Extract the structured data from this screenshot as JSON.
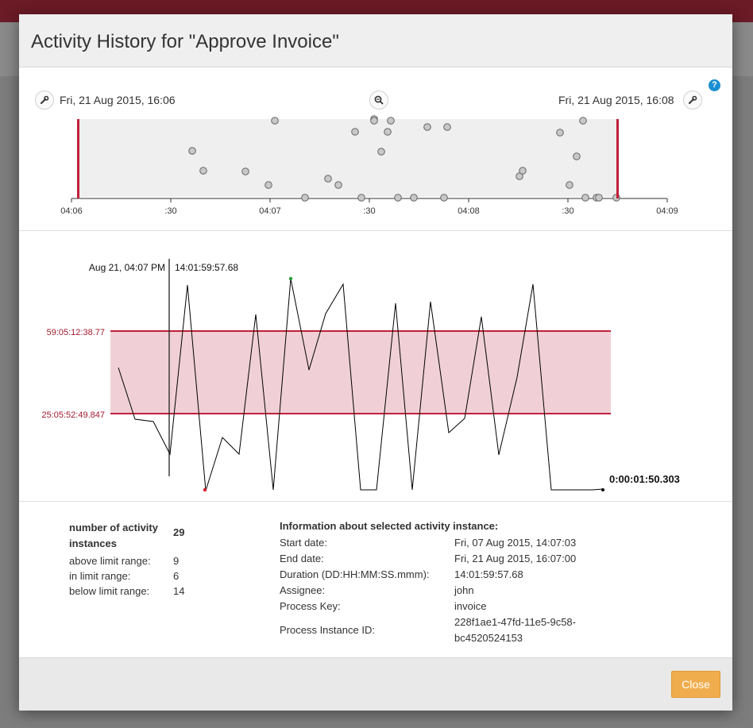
{
  "modal": {
    "title": "Activity History for \"Approve Invoice\""
  },
  "timeline": {
    "start_date": "Fri, 21 Aug 2015, 16:06",
    "end_date": "Fri, 21 Aug 2015, 16:08",
    "ticks": [
      "04:06",
      ":30",
      "04:07",
      ":30",
      "04:08",
      ":30",
      "04:09"
    ]
  },
  "chart_data": [
    {
      "type": "scatter",
      "x_axis_ticks": [
        "04:06",
        ":30",
        "04:07",
        ":30",
        "04:08",
        ":30",
        "04:09"
      ],
      "selection_range": [
        "04:06",
        "04:08:25"
      ]
    },
    {
      "type": "line",
      "hover_label": "Aug 21, 04:07 PM",
      "hover_value": "14:01:59:57.68",
      "upper_limit_label": "59:05:12:38.77",
      "lower_limit_label": "25:05:52:49.847",
      "last_value_label": "0:00:01:50.303",
      "line_color": "#000000",
      "limit_color": "#c0392b",
      "band_color": "#f0d0d6"
    }
  ],
  "stats": {
    "total_label": "number of activity instances",
    "total_value": "29",
    "above_label": "above limit range:",
    "above_value": "9",
    "in_label": "in limit range:",
    "in_value": "6",
    "below_label": "below limit range:",
    "below_value": "14"
  },
  "info": {
    "heading": "Information about selected activity instance:",
    "start_label": "Start date:",
    "start_value": "Fri, 07 Aug 2015, 14:07:03",
    "end_label": "End date:",
    "end_value": "Fri, 21 Aug 2015, 16:07:00",
    "duration_label": "Duration (DD:HH:MM:SS.mmm):",
    "duration_value": "14:01:59:57.68",
    "assignee_label": "Assignee:",
    "assignee_value": "john",
    "process_key_label": "Process Key:",
    "process_key_value": "invoice",
    "process_instance_label": "Process Instance ID:",
    "process_instance_value_1": "228f1ae1-47fd-11e5-9c58-",
    "process_instance_value_2": "bc4520524153"
  },
  "footer": {
    "close_label": "Close"
  },
  "icons": {
    "help": "?",
    "zoom": "zoom-out-icon",
    "wrench": "wrench-icon"
  }
}
